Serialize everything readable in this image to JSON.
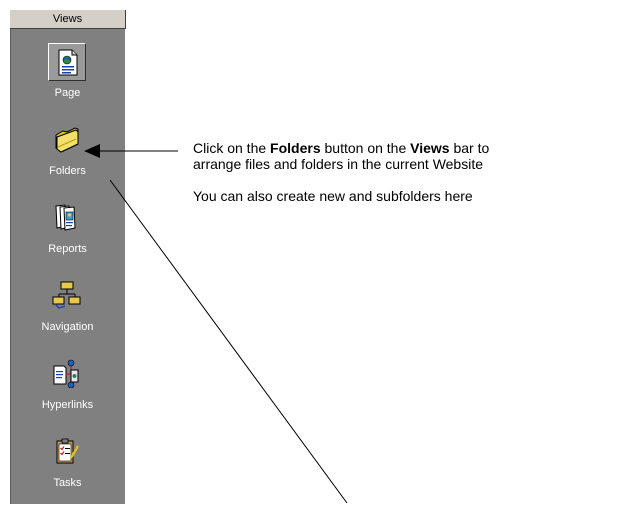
{
  "views_bar": {
    "header": "Views",
    "items": [
      {
        "label": "Page",
        "icon": "page-icon",
        "selected": true
      },
      {
        "label": "Folders",
        "icon": "folder-icon",
        "selected": false
      },
      {
        "label": "Reports",
        "icon": "reports-icon",
        "selected": false
      },
      {
        "label": "Navigation",
        "icon": "navigation-icon",
        "selected": false
      },
      {
        "label": "Hyperlinks",
        "icon": "hyperlinks-icon",
        "selected": false
      },
      {
        "label": "Tasks",
        "icon": "tasks-icon",
        "selected": false
      }
    ]
  },
  "annotation": {
    "line1_a": "Click on the ",
    "line1_b": "Folders",
    "line1_c": " button on the ",
    "line1_d": "Views",
    "line1_e": " bar to",
    "line2": "arrange files and folders in the current Website",
    "line3": "You can also create new and subfolders here"
  },
  "colors": {
    "bar_background": "#808080",
    "header_background": "#d4d0c8",
    "label_color": "#ffffff"
  }
}
